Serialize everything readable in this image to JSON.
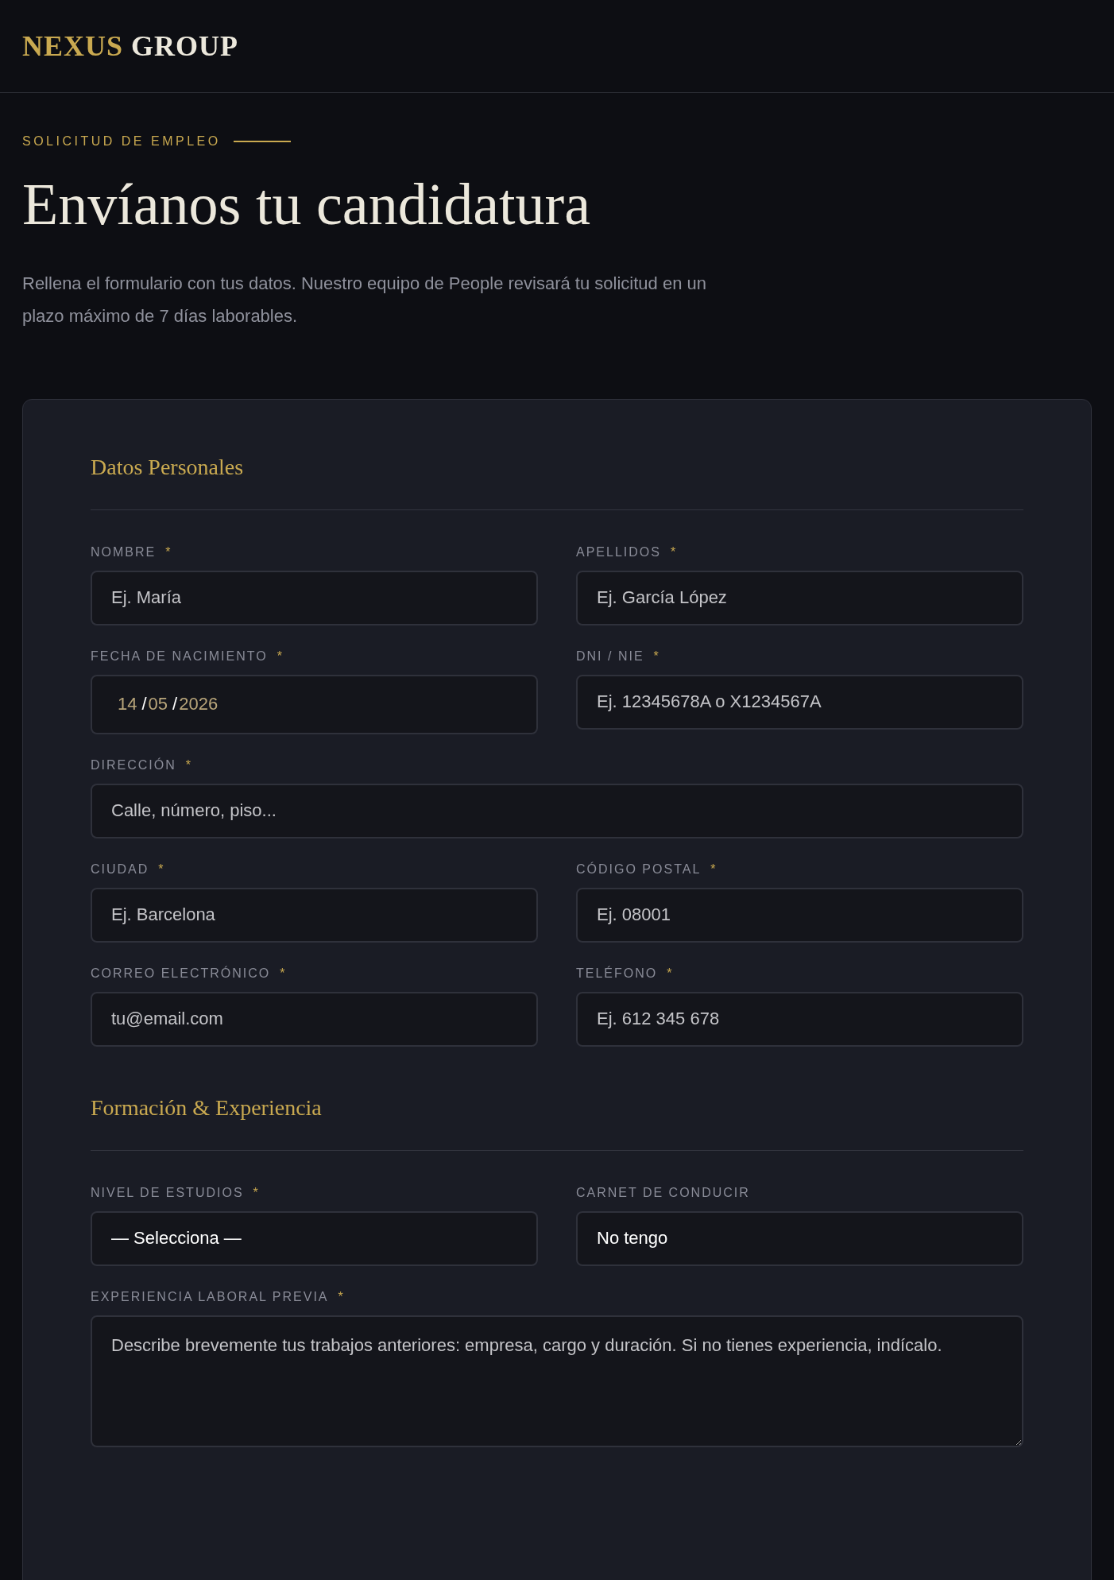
{
  "header": {
    "logo": {
      "accent": "NEXUS",
      "rest": "GROUP"
    }
  },
  "intro": {
    "eyebrow": "SOLICITUD DE EMPLEO",
    "title": "Envíanos tu candidatura",
    "description": "Rellena el formulario con tus datos. Nuestro equipo de People revisará tu solicitud en un plazo máximo de 7 días laborables."
  },
  "sections": [
    {
      "title": "Datos Personales",
      "fields": [
        {
          "label": "NOMBRE",
          "required": true,
          "required_mark": "*",
          "kind": "text",
          "wide": false,
          "placeholder": "Ej. María"
        },
        {
          "label": "APELLIDOS",
          "required": true,
          "required_mark": "*",
          "kind": "text",
          "wide": false,
          "placeholder": "Ej. García López"
        },
        {
          "label": "FECHA DE NACIMIENTO",
          "required": true,
          "required_mark": "*",
          "kind": "date",
          "wide": false,
          "parts": [
            "14",
            "05",
            "2026"
          ],
          "separator": "/"
        },
        {
          "label": "DNI / NIE",
          "required": true,
          "required_mark": "*",
          "kind": "text",
          "wide": false,
          "placeholder": "Ej. 12345678A o X1234567A"
        },
        {
          "label": "DIRECCIÓN",
          "required": true,
          "required_mark": "*",
          "kind": "text",
          "wide": true,
          "placeholder": "Calle, número, piso..."
        },
        {
          "label": "CIUDAD",
          "required": true,
          "required_mark": "*",
          "kind": "text",
          "wide": false,
          "placeholder": "Ej. Barcelona"
        },
        {
          "label": "CÓDIGO POSTAL",
          "required": true,
          "required_mark": "*",
          "kind": "text",
          "wide": false,
          "placeholder": "Ej. 08001"
        },
        {
          "label": "CORREO ELECTRÓNICO",
          "required": true,
          "required_mark": "*",
          "kind": "text",
          "wide": false,
          "placeholder": "tu@email.com"
        },
        {
          "label": "TELÉFONO",
          "required": true,
          "required_mark": "*",
          "kind": "text",
          "wide": false,
          "placeholder": "Ej. 612 345 678"
        }
      ]
    },
    {
      "title": "Formación & Experiencia",
      "fields": [
        {
          "label": "NIVEL DE ESTUDIOS",
          "required": true,
          "required_mark": "*",
          "kind": "select",
          "wide": false,
          "value": "— Selecciona —"
        },
        {
          "label": "CARNET DE CONDUCIR",
          "required": false,
          "kind": "select",
          "wide": false,
          "value": "No tengo"
        },
        {
          "label": "EXPERIENCIA LABORAL PREVIA",
          "required": true,
          "required_mark": "*",
          "kind": "textarea",
          "wide": true,
          "placeholder": "Describe brevemente tus trabajos anteriores: empresa, cargo y duración. Si no tienes experiencia, indícalo."
        }
      ]
    }
  ]
}
